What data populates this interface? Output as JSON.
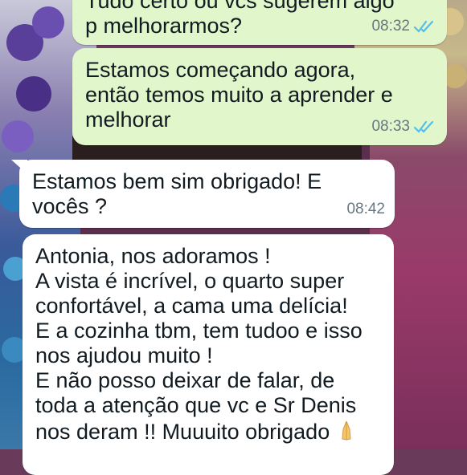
{
  "messages": [
    {
      "id": "m1",
      "direction": "out",
      "text": "Tudo certo ou vcs sugerem algo p melhorarmos?",
      "time": "08:32",
      "read": true
    },
    {
      "id": "m2",
      "direction": "out",
      "text": "Estamos começando agora,\nentão temos muito a aprender e\nmelhorar",
      "time": "08:33",
      "read": true
    },
    {
      "id": "m3",
      "direction": "in",
      "text": "Estamos bem sim obrigado! E\nvocês ?",
      "time": "08:42"
    },
    {
      "id": "m4",
      "direction": "in",
      "text": "Antonia, nos adoramos !\nA vista é incrível, o quarto super\nconfortável, a cama uma delícia!\nE a cozinha tbm, tem tudoo e isso\nnos ajudou muito !\nE não posso deixar de falar, de\ntoda a atenção que vc e Sr Denis\nnos deram !! Muuuito obrigado",
      "emoji": "folded-hands-emoji"
    }
  ],
  "colors": {
    "outgoing": "#e1f7cb",
    "incoming": "#ffffff",
    "read_ticks": "#53bdeb",
    "time": "#667781"
  },
  "icons": {
    "read_receipt": "double-check-icon"
  }
}
